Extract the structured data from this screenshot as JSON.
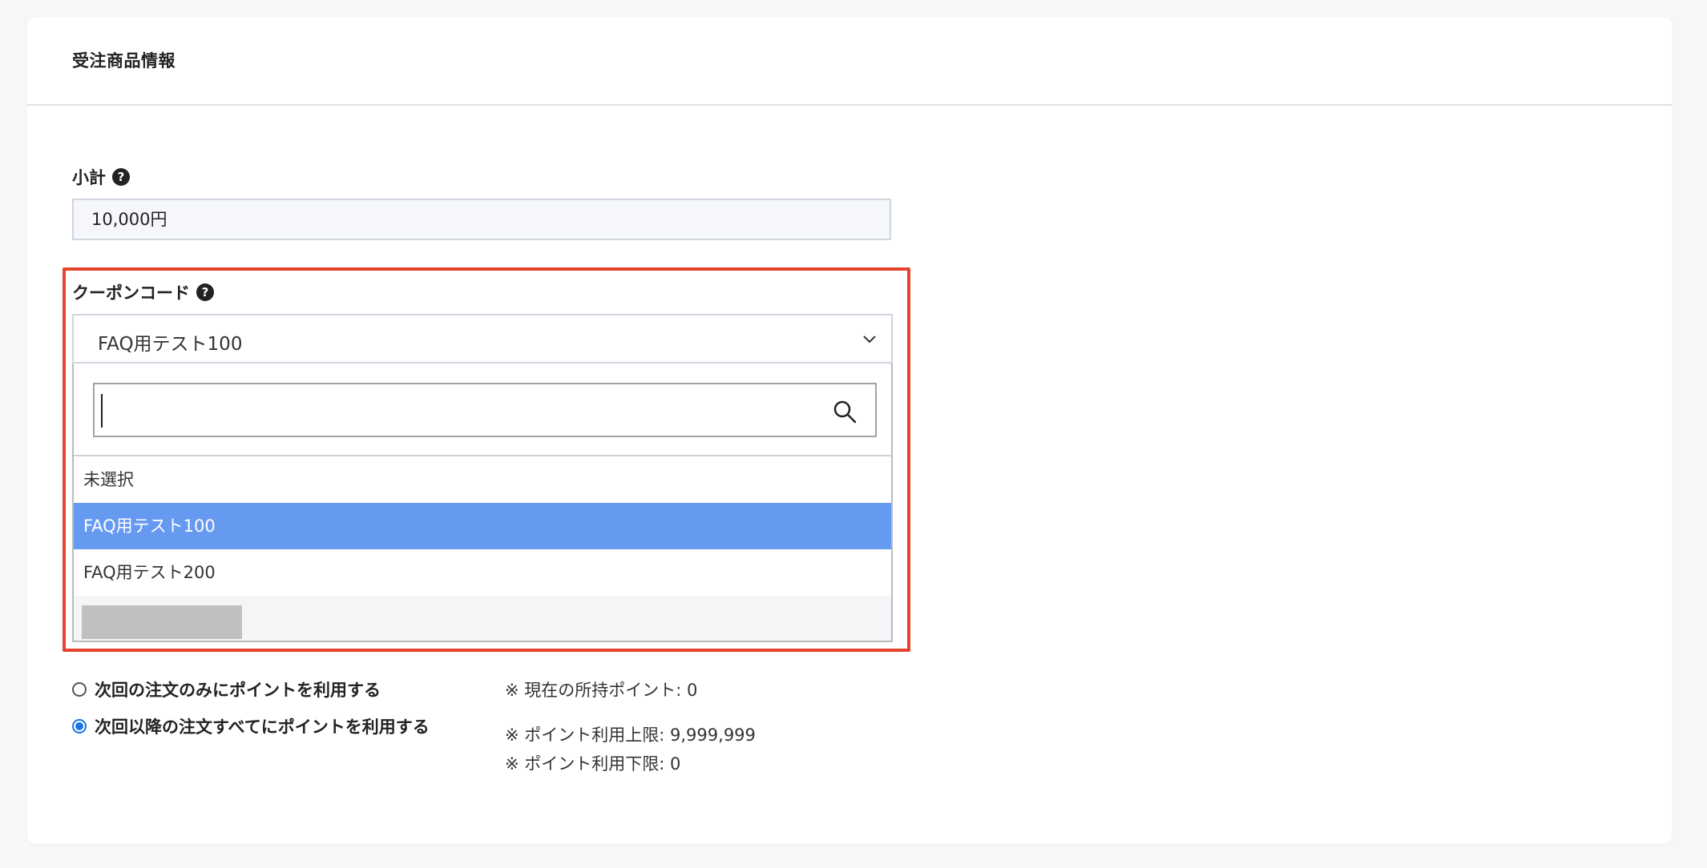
{
  "card": {
    "title": "受注商品情報"
  },
  "subtotal": {
    "label": "小計",
    "value": "10,000円"
  },
  "coupon": {
    "label": "クーポンコード",
    "selected_value": "FAQ用テスト100",
    "search_value": "",
    "options": [
      {
        "label": "未選択"
      },
      {
        "label": "FAQ用テスト100"
      },
      {
        "label": "FAQ用テスト200"
      }
    ]
  },
  "points": {
    "radio_next_only": "次回の注文のみにポイントを利用する",
    "radio_all_future": "次回以降の注文すべてにポイントを利用する",
    "selected": "all_future",
    "note_current": "※ 現在の所持ポイント: 0",
    "note_max": "※ ポイント利用上限: 9,999,999",
    "note_min": "※ ポイント利用下限: 0"
  },
  "colors": {
    "highlight": "#e5432c",
    "selected_option": "#6699f0",
    "radio_accent": "#1a73e8"
  },
  "icons": {
    "help": "question-circle-icon",
    "dropdown": "chevron-down-icon",
    "search": "search-icon"
  }
}
